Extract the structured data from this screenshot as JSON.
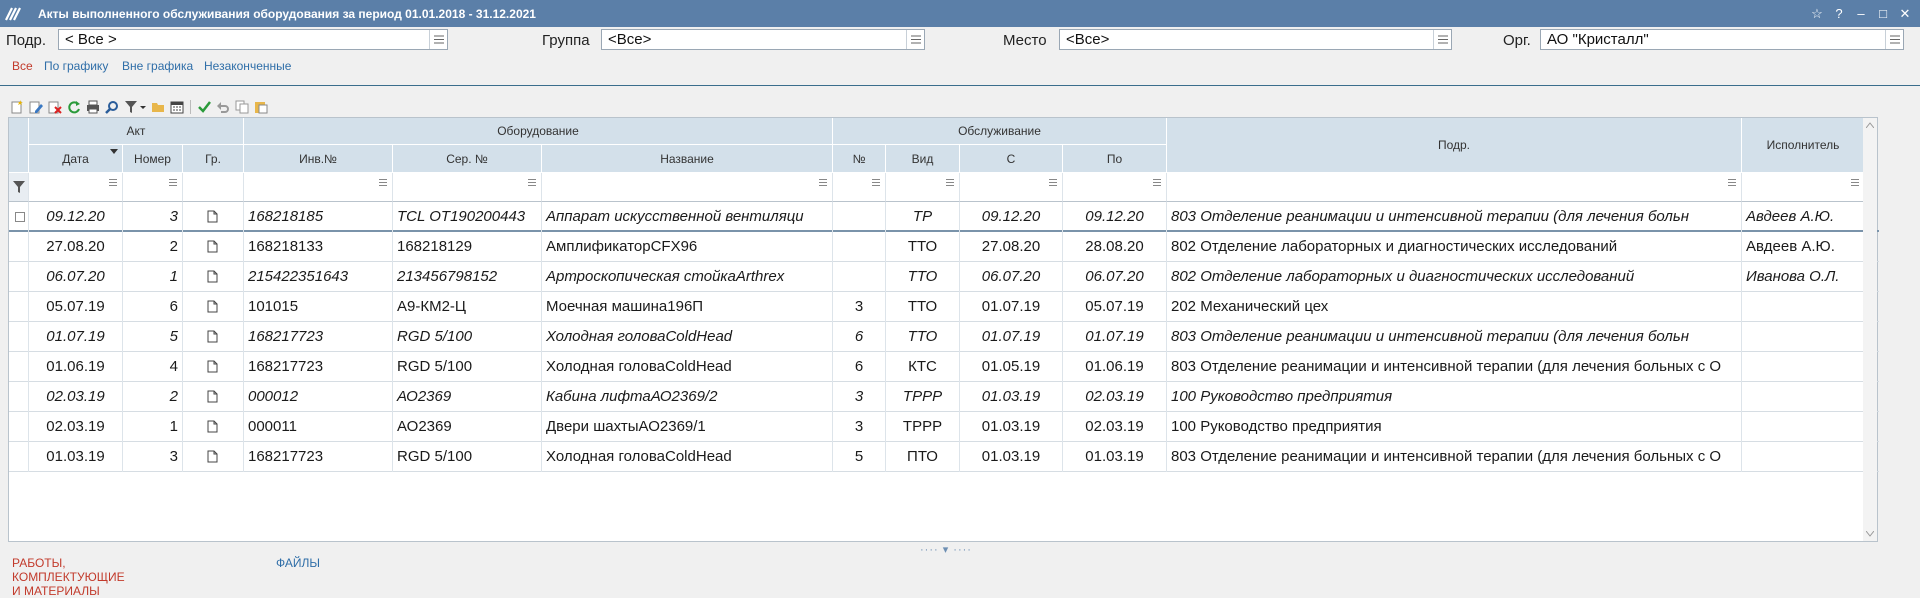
{
  "window": {
    "title": "Акты выполненного обслуживания оборудования за период 01.01.2018 - 31.12.2021",
    "buttons": [
      "☆",
      "?",
      "–",
      "□",
      "✕"
    ]
  },
  "filters": {
    "podr_label": "Подр.",
    "podr_value": "< Все >",
    "group_label": "Группа",
    "group_value": "<Все>",
    "place_label": "Место",
    "place_value": "<Все>",
    "org_label": "Орг.",
    "org_value": "АО \"Кристалл\""
  },
  "tabs": [
    "Все",
    "По графику",
    "Вне графика",
    "Незаконченные"
  ],
  "toolbar_icons": [
    "new-icon",
    "edit-icon",
    "delete-icon",
    "refresh-icon",
    "print-icon",
    "find-icon",
    "filter-icon",
    "folder-icon",
    "calendar-icon",
    "check-icon",
    "undo-icon",
    "copy-icon",
    "paste-icon"
  ],
  "grid": {
    "groups": {
      "akt": "Акт",
      "equipment": "Оборудование",
      "service": "Обслуживание"
    },
    "columns": {
      "date": "Дата",
      "number": "Номер",
      "gr": "Гр.",
      "inv": "Инв.№",
      "ser": "Сер. №",
      "name": "Название",
      "num": "№",
      "kind": "Вид",
      "from": "С",
      "to": "По",
      "podr": "Подр.",
      "executor": "Исполнитель"
    },
    "rows": [
      {
        "italic": true,
        "date": "09.12.20",
        "number": "3",
        "inv": "168218185",
        "ser": "TCL OT190200443",
        "name": "Аппарат искусственной вентиляци",
        "num": "",
        "kind": "ТР",
        "from": "09.12.20",
        "to": "09.12.20",
        "podr": "803 Отделение  реанимации и интенсивной терапии (для лечения больн",
        "executor": "Авдеев А.Ю."
      },
      {
        "italic": false,
        "date": "27.08.20",
        "number": "2",
        "inv": "168218133",
        "ser": "168218129",
        "name": "АмплификаторCFX96",
        "num": "",
        "kind": "ТТО",
        "from": "27.08.20",
        "to": "28.08.20",
        "podr": "802 Отделение лабораторных и диагностических исследований",
        "executor": "Авдеев А.Ю."
      },
      {
        "italic": true,
        "date": "06.07.20",
        "number": "1",
        "inv": "215422351643",
        "ser": "213456798152",
        "name": "Артроскопическая стойкаArthrex",
        "num": "",
        "kind": "ТТО",
        "from": "06.07.20",
        "to": "06.07.20",
        "podr": "802 Отделение лабораторных и диагностических исследований",
        "executor": "Иванова О.Л."
      },
      {
        "italic": false,
        "date": "05.07.19",
        "number": "6",
        "inv": "101015",
        "ser": "А9-КМ2-Ц",
        "name": "Моечная машина196П",
        "num": "3",
        "kind": "ТТО",
        "from": "01.07.19",
        "to": "05.07.19",
        "podr": "202 Механический цех",
        "executor": ""
      },
      {
        "italic": true,
        "date": "01.07.19",
        "number": "5",
        "inv": "168217723",
        "ser": "RGD 5/100",
        "name": "Холодная головаColdHead",
        "num": "6",
        "kind": "ТТО",
        "from": "01.07.19",
        "to": "01.07.19",
        "podr": "803 Отделение  реанимации и интенсивной терапии (для лечения больн",
        "executor": ""
      },
      {
        "italic": false,
        "date": "01.06.19",
        "number": "4",
        "inv": "168217723",
        "ser": "RGD 5/100",
        "name": "Холодная головаColdHead",
        "num": "6",
        "kind": "КТС",
        "from": "01.05.19",
        "to": "01.06.19",
        "podr": "803 Отделение  реанимации и интенсивной терапии (для лечения больных с О",
        "executor": ""
      },
      {
        "italic": true,
        "date": "02.03.19",
        "number": "2",
        "inv": "000012",
        "ser": "АО2369",
        "name": "Кабина лифтаАО2369/2",
        "num": "3",
        "kind": "ТРРР",
        "from": "01.03.19",
        "to": "02.03.19",
        "podr": "100 Руководство предприятия",
        "executor": ""
      },
      {
        "italic": false,
        "date": "02.03.19",
        "number": "1",
        "inv": "000011",
        "ser": "АО2369",
        "name": "Двери шахтыАО2369/1",
        "num": "3",
        "kind": "ТРРР",
        "from": "01.03.19",
        "to": "02.03.19",
        "podr": "100 Руководство предприятия",
        "executor": ""
      },
      {
        "italic": false,
        "date": "01.03.19",
        "number": "3",
        "inv": "168217723",
        "ser": "RGD 5/100",
        "name": "Холодная головаColdHead",
        "num": "5",
        "kind": "ПТО",
        "from": "01.03.19",
        "to": "01.03.19",
        "podr": "803 Отделение  реанимации и интенсивной терапии (для лечения больных с О",
        "executor": ""
      }
    ]
  },
  "bottom_tabs": [
    "РАБОТЫ, КОМПЛЕКТУЮЩИЕ И МАТЕРИАЛЫ",
    "ФАЙЛЫ"
  ],
  "colors": {
    "titlebar": "#5b7fa8",
    "header": "#d3e0ea",
    "active_tab": "#c23a2b",
    "link": "#2f6ea8"
  }
}
